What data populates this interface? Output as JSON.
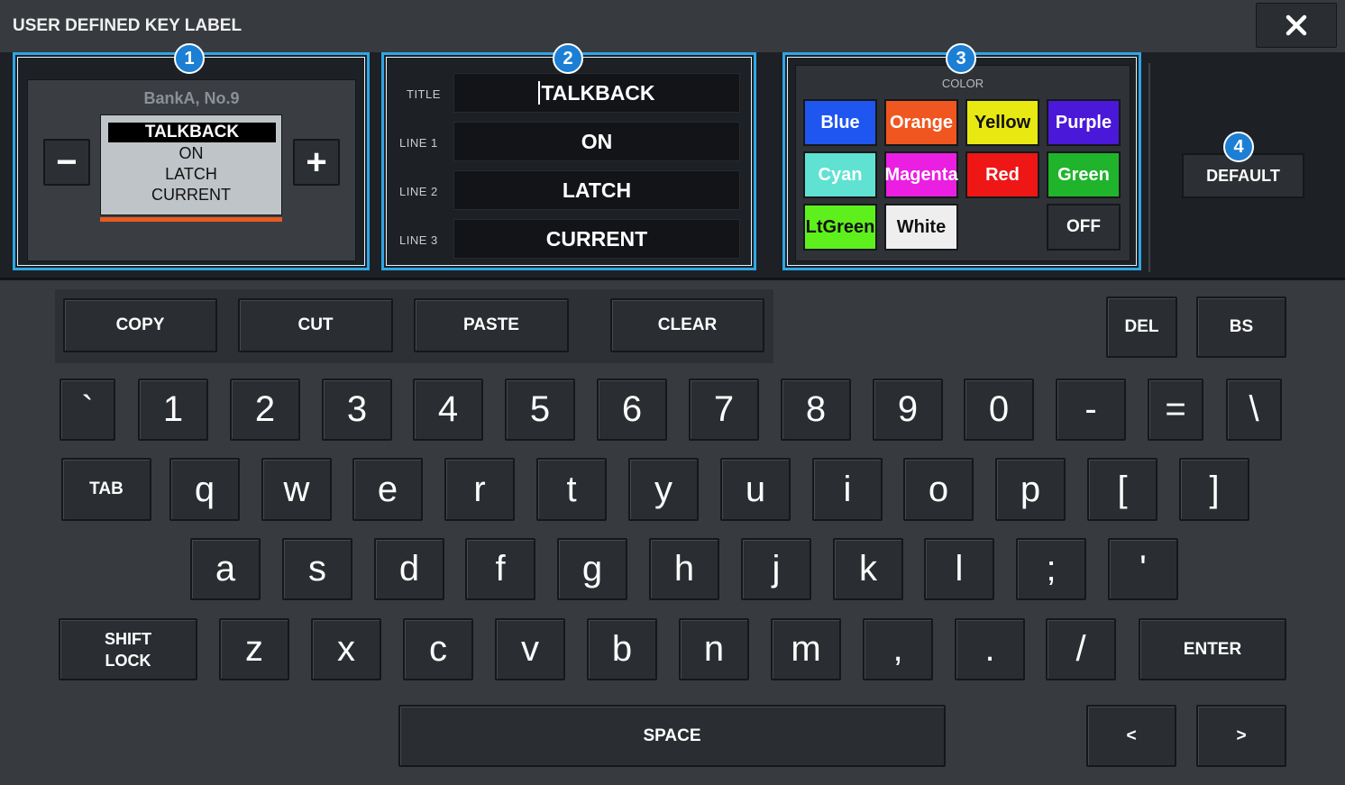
{
  "window": {
    "title": "USER DEFINED KEY LABEL"
  },
  "badges": [
    "1",
    "2",
    "3",
    "4"
  ],
  "preview": {
    "bank": "BankA, No.9",
    "minus": "−",
    "plus": "+",
    "title": "TALKBACK",
    "line1": "ON",
    "line2": "LATCH",
    "line3": "CURRENT",
    "bar_color": "#e85a1f"
  },
  "fields": [
    {
      "label": "TITLE",
      "value": "TALKBACK"
    },
    {
      "label": "LINE 1",
      "value": "ON"
    },
    {
      "label": "LINE 2",
      "value": "LATCH"
    },
    {
      "label": "LINE 3",
      "value": "CURRENT"
    }
  ],
  "color": {
    "label": "COLOR",
    "buttons": [
      {
        "label": "Blue",
        "bg": "#1f56f0",
        "fg": "#ffffff"
      },
      {
        "label": "Orange",
        "bg": "#f0561f",
        "fg": "#ffffff"
      },
      {
        "label": "Yellow",
        "bg": "#e8e812",
        "fg": "#111111"
      },
      {
        "label": "Purple",
        "bg": "#4a18d8",
        "fg": "#ffffff"
      },
      {
        "label": "Cyan",
        "bg": "#5fe2d2",
        "fg": "#ffffff"
      },
      {
        "label": "Magenta",
        "bg": "#ea1fe2",
        "fg": "#ffffff"
      },
      {
        "label": "Red",
        "bg": "#ef1616",
        "fg": "#ffffff"
      },
      {
        "label": "Green",
        "bg": "#1fb42c",
        "fg": "#ffffff"
      },
      {
        "label": "LtGreen",
        "bg": "#5ef01c",
        "fg": "#111111"
      },
      {
        "label": "White",
        "bg": "#eeeeee",
        "fg": "#111111"
      },
      {
        "label": "OFF",
        "bg": "#2c3034",
        "fg": "#ffffff"
      }
    ]
  },
  "default_label": "DEFAULT",
  "edit": {
    "copy": "COPY",
    "cut": "CUT",
    "paste": "PASTE",
    "clear": "CLEAR",
    "del": "DEL",
    "bs": "BS"
  },
  "keys": {
    "row1": [
      "`",
      "1",
      "2",
      "3",
      "4",
      "5",
      "6",
      "7",
      "8",
      "9",
      "0",
      "-",
      "=",
      "\\"
    ],
    "tab": "TAB",
    "row2": [
      "q",
      "w",
      "e",
      "r",
      "t",
      "y",
      "u",
      "i",
      "o",
      "p",
      "[",
      "]"
    ],
    "row3": [
      "a",
      "s",
      "d",
      "f",
      "g",
      "h",
      "j",
      "k",
      "l",
      ";",
      "'"
    ],
    "shift": "SHIFT\nLOCK",
    "row4": [
      "z",
      "x",
      "c",
      "v",
      "b",
      "n",
      "m",
      ",",
      ".",
      "/"
    ],
    "enter": "ENTER",
    "space": "SPACE",
    "left": "<",
    "right": ">"
  },
  "colors": {
    "accent": "#2fa6e6",
    "badge": "#1c7fd4",
    "background": "#373b40",
    "top_background": "#1d2024"
  }
}
